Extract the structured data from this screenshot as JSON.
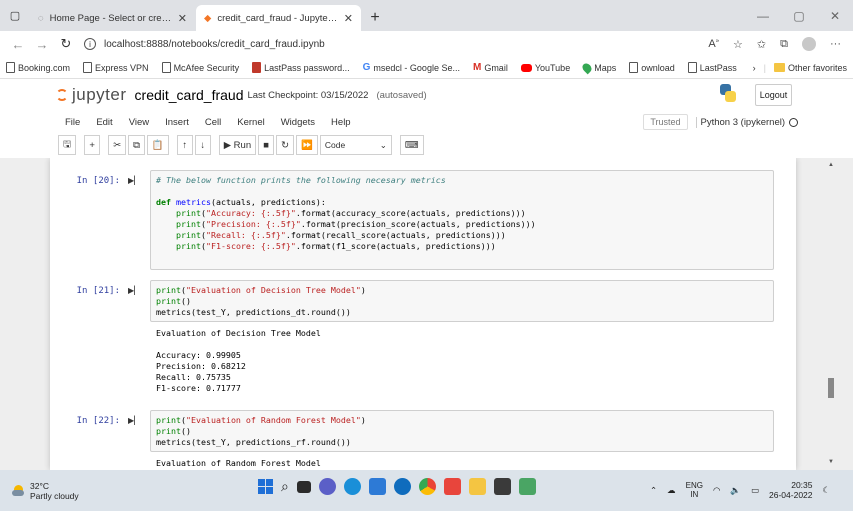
{
  "browser": {
    "tabs": [
      {
        "title": "Home Page - Select or create a n",
        "active": false
      },
      {
        "title": "credit_card_fraud - Jupyter Notel",
        "active": true
      }
    ],
    "new_tab": "+",
    "url": "localhost:8888/notebooks/credit_card_fraud.ipynb",
    "bookmarks": [
      "Booking.com",
      "Express VPN",
      "McAfee Security",
      "LastPass password...",
      "msedcl - Google Se...",
      "Gmail",
      "YouTube",
      "Maps",
      "ownload",
      "LastPass"
    ],
    "other_favorites": "Other favorites"
  },
  "jupyter": {
    "logo_text": "jupyter",
    "notebook_name": "credit_card_fraud",
    "checkpoint": "Last Checkpoint: 03/15/2022",
    "autosave": "(autosaved)",
    "logout": "Logout",
    "menu": [
      "File",
      "Edit",
      "View",
      "Insert",
      "Cell",
      "Kernel",
      "Widgets",
      "Help"
    ],
    "trusted": "Trusted",
    "kernel": "Python 3 (ipykernel)",
    "toolbar": {
      "run_label": "Run",
      "cell_type": "Code"
    }
  },
  "cells": [
    {
      "prompt": "In [20]:",
      "input_lines": [
        {
          "parts": [
            {
              "cls": "cm-comment",
              "text": "# The below function prints the following necesary metrics"
            }
          ]
        },
        {
          "parts": [
            {
              "cls": "",
              "text": ""
            }
          ]
        },
        {
          "parts": [
            {
              "cls": "cm-kw",
              "text": "def "
            },
            {
              "cls": "cm-def",
              "text": "metrics"
            },
            {
              "cls": "",
              "text": "(actuals, predictions):"
            }
          ]
        },
        {
          "parts": [
            {
              "cls": "",
              "text": "    "
            },
            {
              "cls": "cm-builtin",
              "text": "print"
            },
            {
              "cls": "",
              "text": "("
            },
            {
              "cls": "cm-str",
              "text": "\"Accuracy: {:.5f}\""
            },
            {
              "cls": "",
              "text": ".format(accuracy_score(actuals, predictions)))"
            }
          ]
        },
        {
          "parts": [
            {
              "cls": "",
              "text": "    "
            },
            {
              "cls": "cm-builtin",
              "text": "print"
            },
            {
              "cls": "",
              "text": "("
            },
            {
              "cls": "cm-str",
              "text": "\"Precision: {:.5f}\""
            },
            {
              "cls": "",
              "text": ".format(precision_score(actuals, predictions)))"
            }
          ]
        },
        {
          "parts": [
            {
              "cls": "",
              "text": "    "
            },
            {
              "cls": "cm-builtin",
              "text": "print"
            },
            {
              "cls": "",
              "text": "("
            },
            {
              "cls": "cm-str",
              "text": "\"Recall: {:.5f}\""
            },
            {
              "cls": "",
              "text": ".format(recall_score(actuals, predictions)))"
            }
          ]
        },
        {
          "parts": [
            {
              "cls": "",
              "text": "    "
            },
            {
              "cls": "cm-builtin",
              "text": "print"
            },
            {
              "cls": "",
              "text": "("
            },
            {
              "cls": "cm-str",
              "text": "\"F1-score: {:.5f}\""
            },
            {
              "cls": "",
              "text": ".format(f1_score(actuals, predictions)))"
            }
          ]
        },
        {
          "parts": [
            {
              "cls": "",
              "text": ""
            }
          ]
        },
        {
          "parts": [
            {
              "cls": "",
              "text": ""
            }
          ]
        }
      ],
      "output_lines": []
    },
    {
      "prompt": "In [21]:",
      "input_lines": [
        {
          "parts": [
            {
              "cls": "cm-builtin",
              "text": "print"
            },
            {
              "cls": "",
              "text": "("
            },
            {
              "cls": "cm-str",
              "text": "\"Evaluation of Decision Tree Model\""
            },
            {
              "cls": "",
              "text": ")"
            }
          ]
        },
        {
          "parts": [
            {
              "cls": "cm-builtin",
              "text": "print"
            },
            {
              "cls": "",
              "text": "()"
            }
          ]
        },
        {
          "parts": [
            {
              "cls": "",
              "text": "metrics(test_Y, predictions_dt.round())"
            }
          ]
        }
      ],
      "output_lines": [
        "Evaluation of Decision Tree Model",
        "",
        "Accuracy: 0.99905",
        "Precision: 0.68212",
        "Recall: 0.75735",
        "F1-score: 0.71777"
      ]
    },
    {
      "prompt": "In [22]:",
      "input_lines": [
        {
          "parts": [
            {
              "cls": "cm-builtin",
              "text": "print"
            },
            {
              "cls": "",
              "text": "("
            },
            {
              "cls": "cm-str",
              "text": "\"Evaluation of Random Forest Model\""
            },
            {
              "cls": "",
              "text": ")"
            }
          ]
        },
        {
          "parts": [
            {
              "cls": "cm-builtin",
              "text": "print"
            },
            {
              "cls": "",
              "text": "()"
            }
          ]
        },
        {
          "parts": [
            {
              "cls": "",
              "text": "metrics(test_Y, predictions_rf.round())"
            }
          ]
        }
      ],
      "output_lines": [
        "Evaluation of Random Forest Model"
      ]
    }
  ],
  "taskbar": {
    "temperature": "32°C",
    "weather": "Partly cloudy",
    "lang_top": "ENG",
    "lang_bottom": "IN",
    "time": "20:35",
    "date": "26-04-2022"
  },
  "colors": {
    "jupyter_orange": "#f37626",
    "prompt_blue": "#303f9f",
    "string_red": "#ba2121",
    "comment_teal": "#408080",
    "keyword_green": "#008000"
  }
}
